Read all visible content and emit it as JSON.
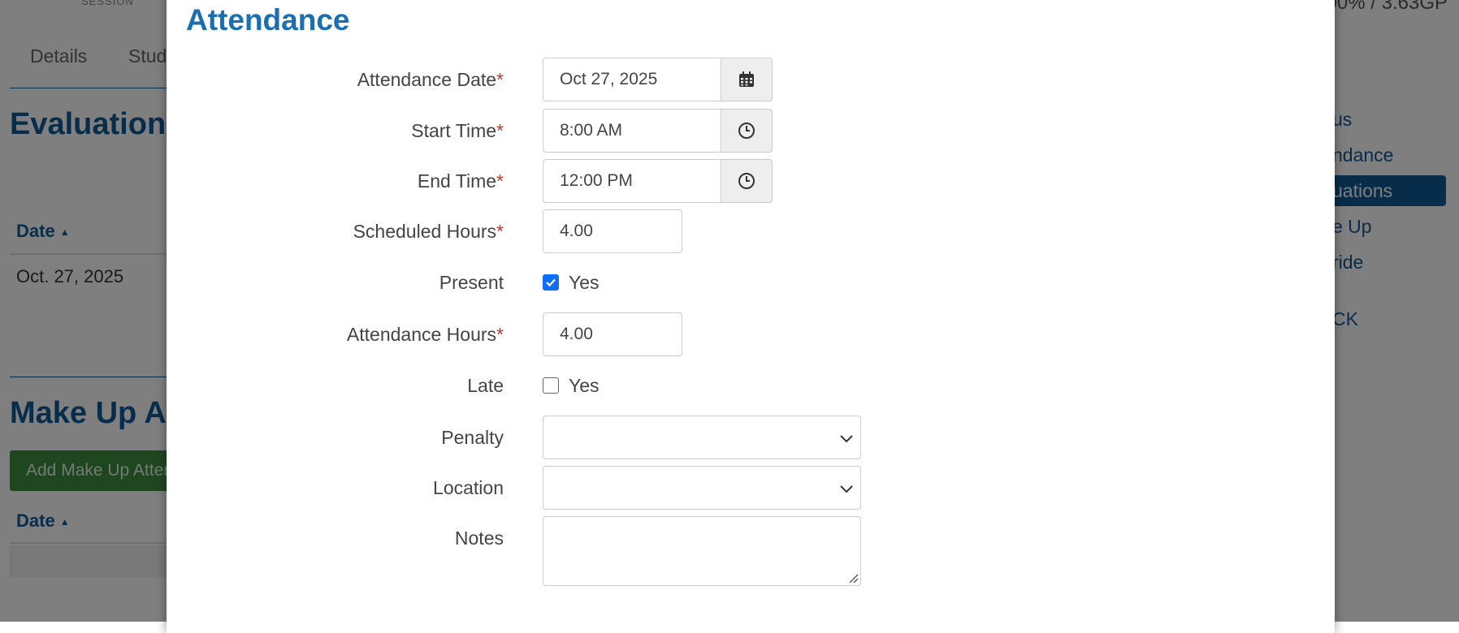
{
  "background": {
    "session_label": "SESSION",
    "gpa_text": "00% / 3.63GP",
    "tabs": [
      "Details",
      "Stud"
    ],
    "evaluation_heading": "Evaluation A",
    "evaluation_table": {
      "date_header": "Date",
      "row_date": "Oct. 27, 2025"
    },
    "makeup_heading": "Make Up Att",
    "makeup_button": "Add Make Up Atten",
    "makeup_table": {
      "date_header": "Date"
    },
    "sidebar": [
      "us",
      "ndance",
      "uations",
      "e Up",
      "ride",
      "CK"
    ]
  },
  "modal": {
    "title": "Attendance",
    "fields": {
      "attendance_date": {
        "label": "Attendance Date",
        "value": "Oct 27, 2025",
        "icon": "calendar-icon"
      },
      "start_time": {
        "label": "Start Time",
        "value": "8:00 AM",
        "icon": "clock-icon"
      },
      "end_time": {
        "label": "End Time",
        "value": "12:00 PM",
        "icon": "clock-icon"
      },
      "scheduled_hours": {
        "label": "Scheduled Hours",
        "value": "4.00"
      },
      "present": {
        "label": "Present",
        "option": "Yes",
        "checked": true
      },
      "attendance_hours": {
        "label": "Attendance Hours",
        "value": "4.00"
      },
      "late": {
        "label": "Late",
        "option": "Yes",
        "checked": false
      },
      "penalty": {
        "label": "Penalty",
        "value": ""
      },
      "location": {
        "label": "Location",
        "value": ""
      },
      "notes": {
        "label": "Notes",
        "value": ""
      }
    },
    "required_marker": "*"
  },
  "colors": {
    "accent": "#1b6fb0",
    "dark_accent": "#0f5a96",
    "required": "#c0392b",
    "checkbox": "#0d6efd",
    "green": "#3e8e3e"
  }
}
